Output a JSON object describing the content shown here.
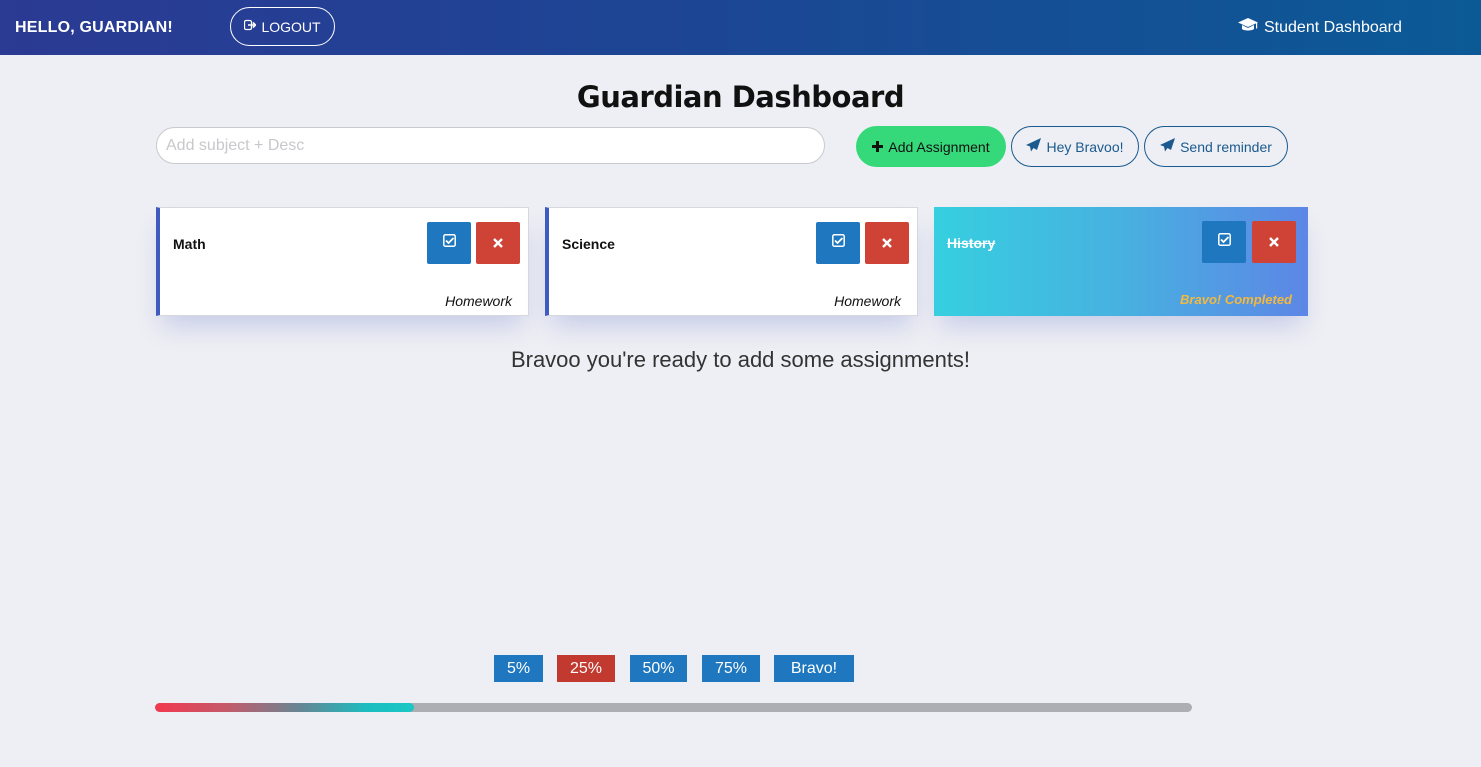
{
  "header": {
    "greeting": "HELLO, GUARDIAN!",
    "logout_label": "LOGOUT",
    "student_link_label": "Student Dashboard"
  },
  "main": {
    "title": "Guardian Dashboard",
    "input_placeholder": "Add subject + Desc",
    "input_value": "",
    "add_button_label": "Add Assignment",
    "hey_button_label": "Hey Bravoo!",
    "reminder_button_label": "Send reminder",
    "ready_message": "Bravoo you're ready to add some assignments!"
  },
  "assignments": [
    {
      "subject": "Math",
      "description": "Homework",
      "completed": false
    },
    {
      "subject": "Science",
      "description": "Homework",
      "completed": false
    },
    {
      "subject": "History",
      "description": "Bravo! Completed",
      "completed": true
    }
  ],
  "progress": {
    "milestones": [
      "5%",
      "25%",
      "50%",
      "75%",
      "Bravo!"
    ],
    "active_milestone": "25%",
    "fill_percent": 25
  },
  "colors": {
    "header_start": "#2b3a93",
    "header_end": "#0b5a96",
    "add_button": "#36d97a",
    "check_button": "#1e77bf",
    "delete_button": "#cf4236",
    "completed_text": "#f3b93f",
    "active_milestone": "#c2392f"
  }
}
